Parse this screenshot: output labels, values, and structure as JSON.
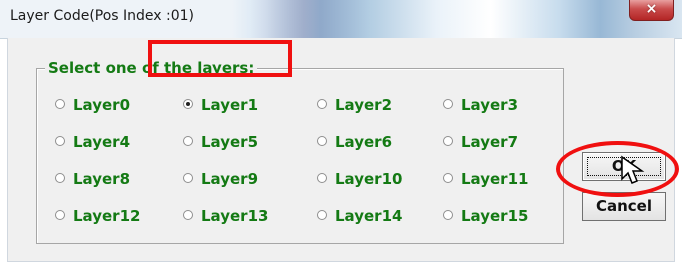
{
  "window": {
    "title": "Layer Code(Pos Index :01)",
    "close_icon": "×"
  },
  "group": {
    "label": "Select one of the layers:"
  },
  "layers": [
    {
      "label": "Layer0",
      "checked": false
    },
    {
      "label": "Layer1",
      "checked": true
    },
    {
      "label": "Layer2",
      "checked": false
    },
    {
      "label": "Layer3",
      "checked": false
    },
    {
      "label": "Layer4",
      "checked": false
    },
    {
      "label": "Layer5",
      "checked": false
    },
    {
      "label": "Layer6",
      "checked": false
    },
    {
      "label": "Layer7",
      "checked": false
    },
    {
      "label": "Layer8",
      "checked": false
    },
    {
      "label": "Layer9",
      "checked": false
    },
    {
      "label": "Layer10",
      "checked": false
    },
    {
      "label": "Layer11",
      "checked": false
    },
    {
      "label": "Layer12",
      "checked": false
    },
    {
      "label": "Layer13",
      "checked": false
    },
    {
      "label": "Layer14",
      "checked": false
    },
    {
      "label": "Layer15",
      "checked": false
    }
  ],
  "buttons": {
    "ok": "OK",
    "cancel": "Cancel"
  },
  "colors": {
    "label_text": "#147A14",
    "highlight": "#F01010"
  },
  "icons": {
    "close": "close-icon",
    "cursor": "mouse-pointer-icon"
  }
}
